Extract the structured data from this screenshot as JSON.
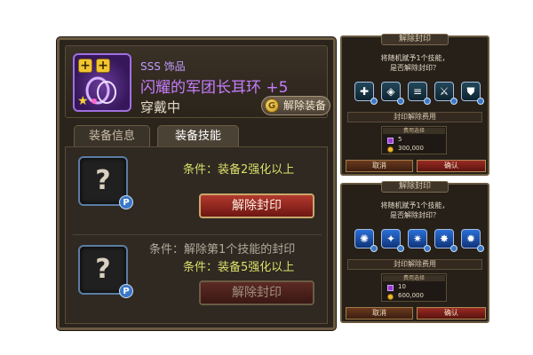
{
  "colors": {
    "purple_name": "#c77dff",
    "condition_yellow": "#dcdf6a",
    "red_button": "#b2392e"
  },
  "item": {
    "grade": "SSS 饰品",
    "name": "闪耀的军团长耳环 +5",
    "status": "穿戴中",
    "unequip_label": "解除装备",
    "icon": "earring-icon"
  },
  "tabs": [
    {
      "label": "装备信息",
      "active": false
    },
    {
      "label": "装备技能",
      "active": true
    }
  ],
  "skills": [
    {
      "icon": "unknown-skill-icon",
      "badge": "P",
      "conditions": [
        "条件：装备2强化以上"
      ],
      "button": "解除封印",
      "enabled": true
    },
    {
      "icon": "unknown-skill-icon",
      "badge": "P",
      "conditions": [
        "条件：解除第1个技能的封印",
        "条件：装备5强化以上"
      ],
      "button": "解除封印",
      "enabled": false
    }
  ],
  "dialogs": [
    {
      "title": "解除封印",
      "message_line1": "将随机赋予1个技能，",
      "message_line2": "是否解除封印？",
      "skill_style": "gray",
      "cost_title": "封印解除费用",
      "cost_subtitle": "费用选择",
      "cost_gem": "5",
      "cost_gold": "300,000",
      "cancel_label": "取消",
      "ok_label": "确认"
    },
    {
      "title": "解除封印",
      "message_line1": "将随机赋予1个技能，",
      "message_line2": "是否解除封印？",
      "skill_style": "blue",
      "cost_title": "封印解除费用",
      "cost_subtitle": "费用选择",
      "cost_gem": "10",
      "cost_gold": "600,000",
      "cancel_label": "取消",
      "ok_label": "确认"
    }
  ]
}
